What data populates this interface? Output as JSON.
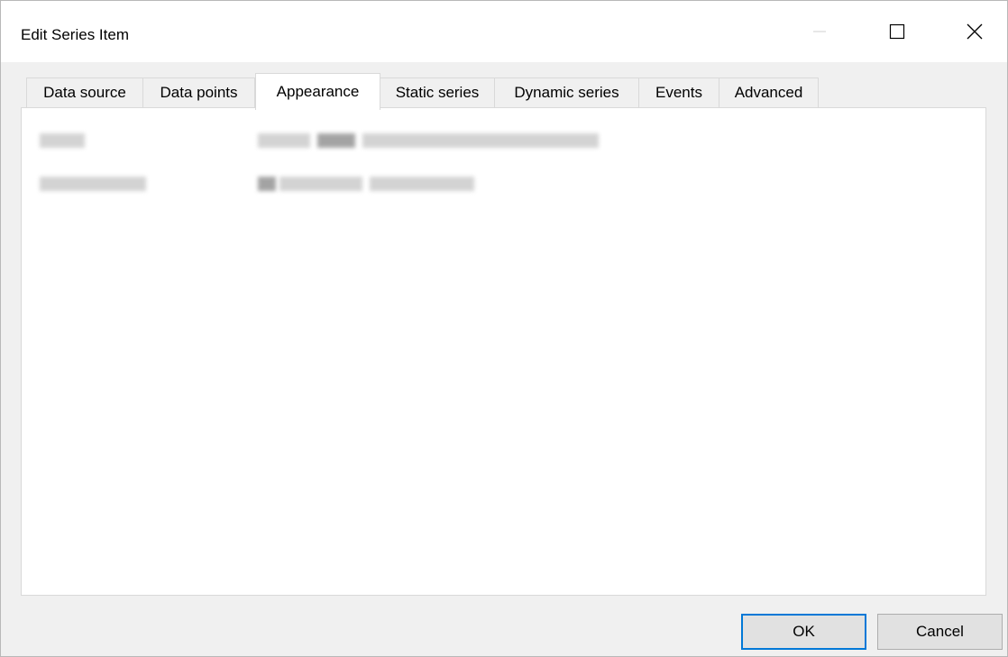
{
  "window": {
    "title": "Edit Series Item"
  },
  "icons": {
    "minimize": "minimize-icon",
    "maximize": "maximize-icon",
    "close": "close-icon"
  },
  "tabs": [
    {
      "label": "Data source",
      "active": false
    },
    {
      "label": "Data points",
      "active": false
    },
    {
      "label": "Appearance",
      "active": true
    },
    {
      "label": "Static series",
      "active": false
    },
    {
      "label": "Dynamic series",
      "active": false
    },
    {
      "label": "Events",
      "active": false
    },
    {
      "label": "Advanced",
      "active": false
    }
  ],
  "buttons": {
    "ok": "OK",
    "cancel": "Cancel"
  },
  "colors": {
    "accent": "#0078d7",
    "window_bg": "#f0f0f0",
    "panel_bg": "#ffffff"
  }
}
